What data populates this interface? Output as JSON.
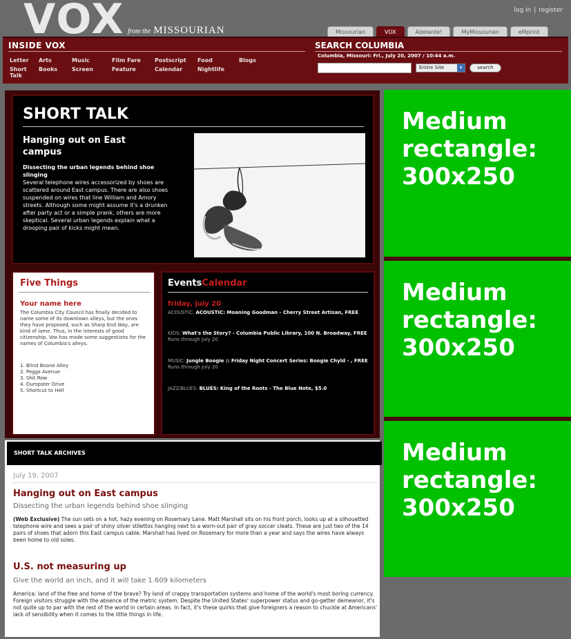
{
  "header": {
    "logo": "VOX",
    "from_small": "from the",
    "from_big": "MISSOURIAN",
    "login": "log in",
    "register": "register",
    "tabs": [
      "Missourian",
      "VOX",
      "Adelante!",
      "MyMissourian",
      "eMprint"
    ],
    "active_tab": "VOX"
  },
  "inside_vox": {
    "title": "INSIDE VOX",
    "nav": [
      "Letter",
      "Arts",
      "Music",
      "Film Fare",
      "Postscript",
      "Food",
      "Blogs",
      "Short Talk",
      "Books",
      "Screen",
      "Feature",
      "Calendar",
      "Nightlife"
    ]
  },
  "search": {
    "title": "SEARCH COLUMBIA",
    "dateline": "Columbia, Missouri: Fri., July 20, 2007 / 10:44 a.m.",
    "input_value": "",
    "scope": "Entire Site",
    "button": "search"
  },
  "short_talk": {
    "title": "SHORT TALK",
    "headline": "Hanging out on East campus",
    "subhead": "Dissecting the urban legends behind shoe slinging",
    "body": "Several telephone wires accessorized by shoes are scattered around East campus. There are also shoes suspended on wires that line William and Amory streets. Although some might assume it's a drunken after party act or a simple prank, others are more skeptical. Several urban legends explain what a drooping pair of kicks might mean."
  },
  "five_things": {
    "title": "Five Things",
    "subhead": "Your name here",
    "body": "The Columbia City Council has finally decided to name some of its downtown alleys, but the ones they have proposed, such as Sharp End Way, are kind of lame. Thus, in the interests of good citizenship, Vox has made some suggestions for the names of Columbia's alleys.",
    "items": [
      "1. Blind Boone Alley",
      "2. Peggs Avenue",
      "3. Shit Row",
      "4. Dumpster Drive",
      "5. Shortcut to Hell"
    ]
  },
  "events": {
    "title": "Events",
    "title_red": "Calendar",
    "date": "friday, july 20",
    "items": [
      {
        "cat": "ACOUSTIC:",
        "text": "ACOUSTIC: Moaning Goodman - Cherry Street Artisan, FREE",
        "runs": ""
      },
      {
        "cat": "KIDS:",
        "text": "What's the Story? - Columbia Public Library, 100 N. Broadway, FREE",
        "runs": "Runs through July 20"
      },
      {
        "cat": "MUSIC:",
        "text": "Jungle Boogie :: Friday Night Concert Series: Boogie Chyld - , FREE",
        "runs": "Runs through July 20"
      },
      {
        "cat": "JAZZ/BLUES:",
        "text": "BLUES: King of the Roots - The Blue Note, $5.0",
        "runs": ""
      }
    ]
  },
  "archives": {
    "header": "SHORT TALK ARCHIVES",
    "date": "July 19, 2007",
    "stories": [
      {
        "headline": "Hanging out on East campus",
        "subhead": "Dissecting the urban legends behind shoe slinging",
        "lead": "(Web Exclusive)",
        "body": "The sun sets on a hot, hazy evening on Rosemary Lane. Matt Marshall sits on his front porch, looks up at a silhouetted telephone wire and sees a pair of shiny silver stilettos hanging next to a worn-out pair of gray soccer cleats. These are just two of the 14 pairs of shoes that adorn this East campus cable. Marshall has lived on Rosemary for more than a year and says the wires have always been home to old soles."
      },
      {
        "headline": "U.S. not measuring up",
        "subhead": "Give the world an inch, and it will take 1.609 kilometers",
        "lead": "",
        "body": "America: land of the free and home of the brave? Try land of crappy transportation systems and home of the world's most boring currency. Foreign visitors struggle with the absence of the metric system. Despite the United States' superpower status and go-getter demeanor, it's not quite up to par with the rest of the world in certain areas. In fact, it's these quirks that give foreigners a reason to chuckle at Americans' lack of sensibility when it comes to the little things in life."
      }
    ]
  },
  "ads": [
    "Medium rectangle: 300x250",
    "Medium rectangle: 300x250",
    "Medium rectangle: 300x250"
  ],
  "colors": {
    "brand_red": "#6a0e12",
    "accent_red": "#c81d1d",
    "ad_green": "#00c000",
    "frame_gray": "#6b6b6b"
  }
}
